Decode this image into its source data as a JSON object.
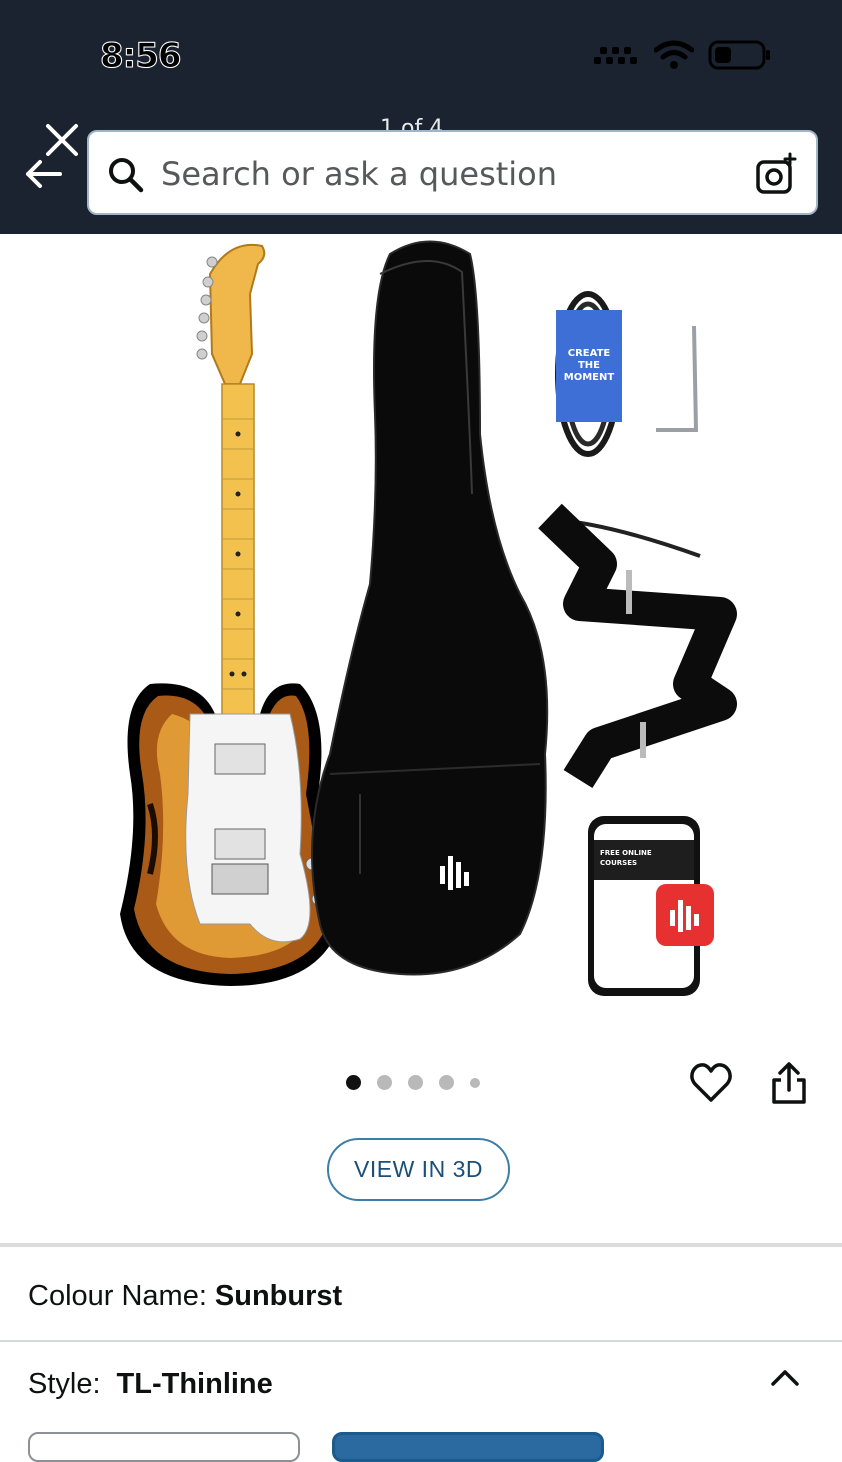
{
  "status_bar": {
    "time": "8:56"
  },
  "header": {
    "counter": "1 of 4",
    "search": {
      "placeholder": "Search or ask a question"
    }
  },
  "gallery": {
    "dots_total": 5,
    "active_index": 0
  },
  "actions": {
    "view_3d_label": "VIEW IN 3D"
  },
  "variations": {
    "colour_label": "Colour Name:",
    "colour_value": "Sunburst",
    "style_label": "Style:",
    "style_value": "TL-Thinline"
  },
  "colors": {
    "header_bg": "#1b2230",
    "accent_blue": "#3c7ea8"
  },
  "images": {
    "cable_band_text": "CREATE THE MOMENT",
    "phone_screen_text": "FREE ONLINE COURSES"
  }
}
